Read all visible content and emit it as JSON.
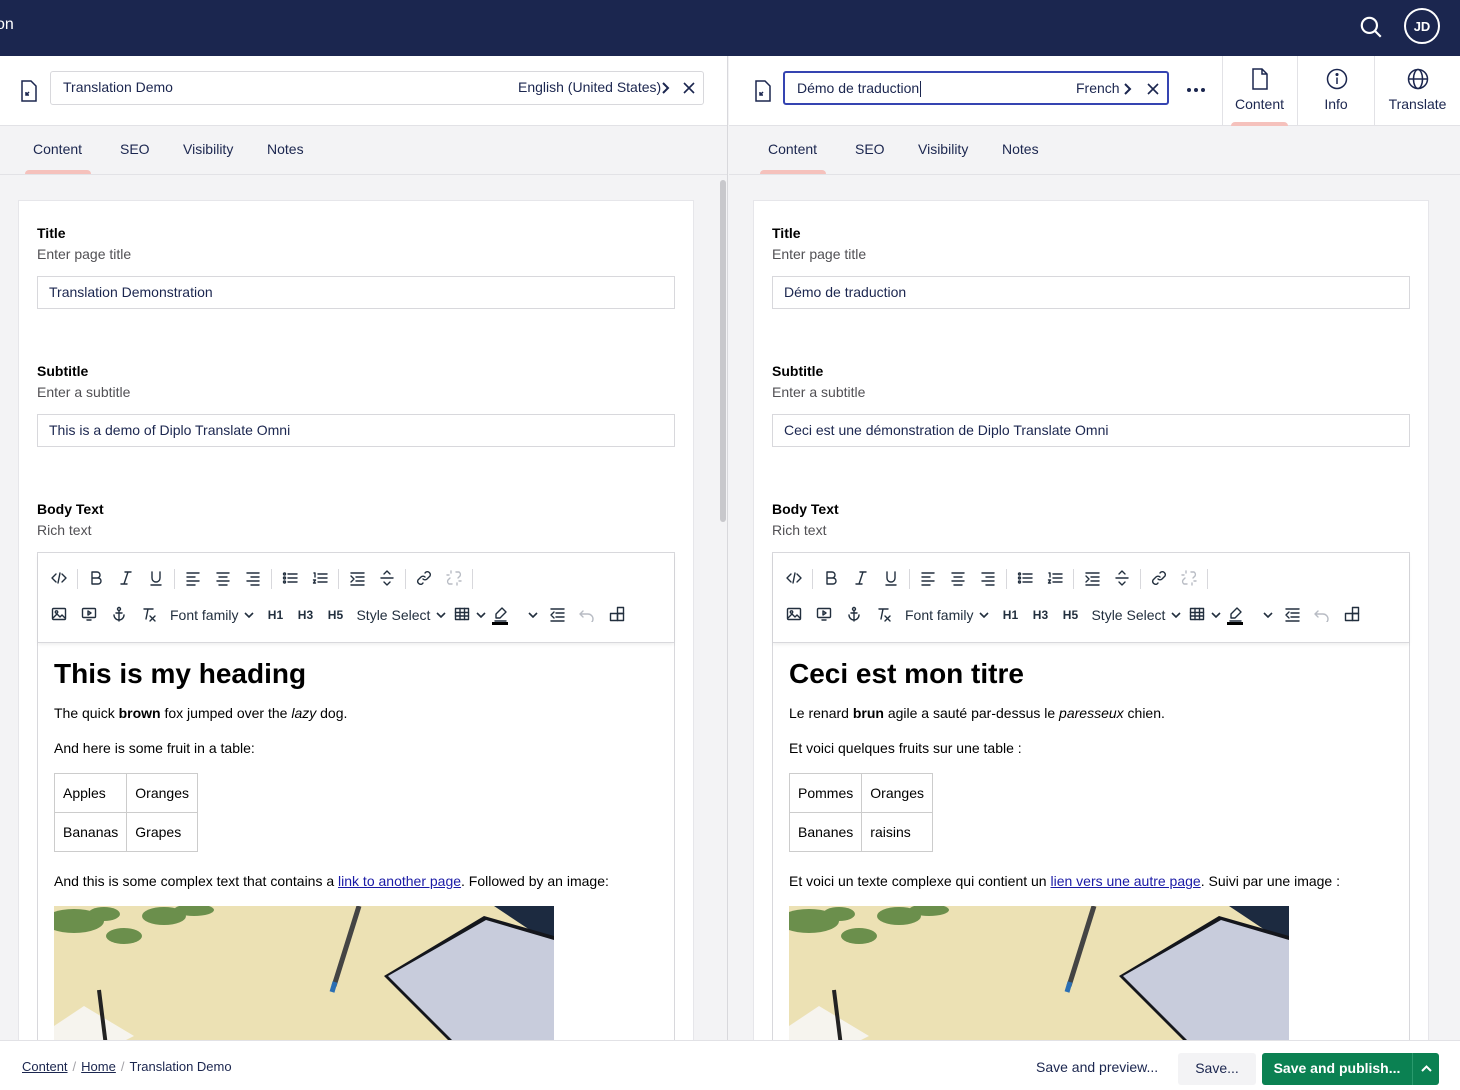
{
  "topbar": {
    "section_name": "on",
    "avatar_initials": "JD",
    "background": "#1b264f"
  },
  "left": {
    "doc_name": "Translation Demo",
    "culture": "English (United States)",
    "tabs": [
      "Content",
      "SEO",
      "Visibility",
      "Notes"
    ],
    "fields": {
      "title_label": "Title",
      "title_desc": "Enter page title",
      "title_value": "Translation Demonstration",
      "subtitle_label": "Subtitle",
      "subtitle_desc": "Enter a subtitle",
      "subtitle_value": "This is a demo of Diplo Translate Omni",
      "body_label": "Body Text",
      "body_desc": "Rich text"
    },
    "body": {
      "heading": "This is my heading",
      "p1_a": "The quick ",
      "p1_bold": "brown",
      "p1_b": " fox jumped over the ",
      "p1_italic": "lazy",
      "p1_c": " dog.",
      "p2": "And here is some fruit in a table:",
      "table": [
        [
          "Apples",
          "Oranges"
        ],
        [
          "Bananas",
          "Grapes"
        ]
      ],
      "p3_a": "And this is some complex text that contains a ",
      "p3_link": "link to another page",
      "p3_b": ". Followed by an image:"
    }
  },
  "right": {
    "doc_name": "Démo de traduction",
    "culture": "French",
    "tabs": [
      "Content",
      "SEO",
      "Visibility",
      "Notes"
    ],
    "fields": {
      "title_label": "Title",
      "title_desc": "Enter page title",
      "title_value": "Démo de traduction",
      "subtitle_label": "Subtitle",
      "subtitle_desc": "Enter a subtitle",
      "subtitle_value": "Ceci est une démonstration de Diplo Translate Omni",
      "body_label": "Body Text",
      "body_desc": "Rich text"
    },
    "body": {
      "heading": "Ceci est mon titre",
      "p1_a": "Le renard ",
      "p1_bold": "brun",
      "p1_b": " agile a sauté par-dessus le ",
      "p1_italic": "paresseux",
      "p1_c": " chien.",
      "p2": "Et voici quelques fruits sur une table :",
      "table": [
        [
          "Pommes",
          "Oranges"
        ],
        [
          "Bananes",
          "raisins"
        ]
      ],
      "p3_a": "Et voici un texte complexe qui contient un ",
      "p3_link": "lien vers une autre page",
      "p3_b": ". Suivi par une image :"
    }
  },
  "apps": [
    {
      "label": "Content",
      "icon": "document-icon"
    },
    {
      "label": "Info",
      "icon": "info-icon"
    },
    {
      "label": "Translate",
      "icon": "globe-icon"
    }
  ],
  "toolbar": {
    "font_family": "Font family",
    "style_select": "Style Select",
    "h1": "H1",
    "h3": "H3",
    "h5": "H5"
  },
  "footer": {
    "breadcrumbs": [
      "Content",
      "Home",
      "Translation Demo"
    ],
    "save_preview": "Save and preview...",
    "save": "Save...",
    "save_publish": "Save and publish..."
  },
  "colors": {
    "accent": "#3544b1",
    "publish": "#0b8152",
    "tab_indicator": "#f5c1bc"
  }
}
